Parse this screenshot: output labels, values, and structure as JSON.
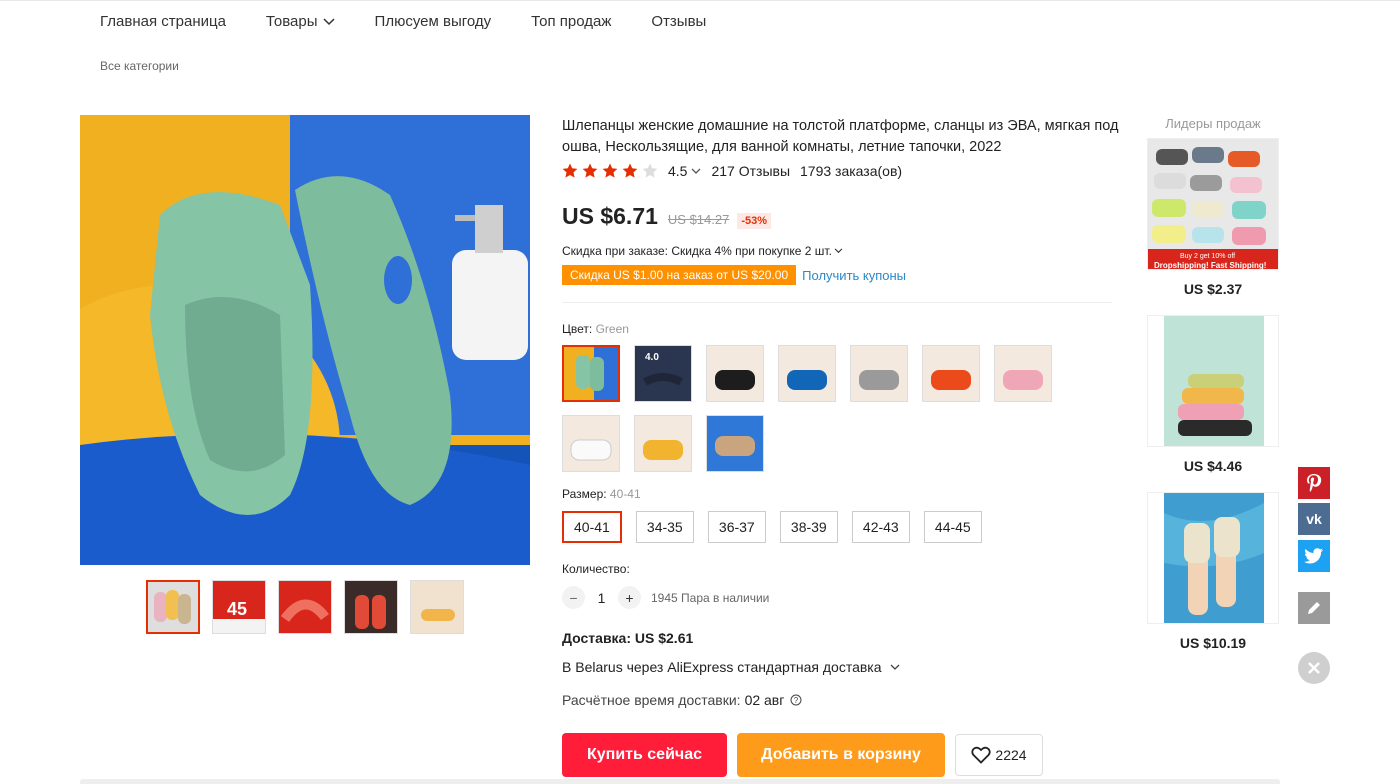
{
  "nav": {
    "home": "Главная страница",
    "products": "Товары",
    "plus": "Плюсуем выгоду",
    "top": "Топ продаж",
    "reviews": "Отзывы"
  },
  "breadcrumb": "Все категории",
  "product": {
    "title": "Шлепанцы женские домашние на толстой платформе, сланцы из ЭВА, мягкая под ошва, Нескользящие, для ванной комнаты, летние тапочки, 2022",
    "rating": "4.5",
    "stars_value": 4.5,
    "reviews": "217 Отзывы",
    "orders": "1793 заказа(ов)",
    "price": "US $6.71",
    "old_price": "US $14.27",
    "discount": "-53%",
    "promo_label": "Скидка при заказе:",
    "promo_text": "Скидка 4% при покупке 2 шт.",
    "coupon": "Скидка US $1.00 на заказ от US $20.00",
    "coupon_link": "Получить купоны"
  },
  "color": {
    "label": "Цвет:",
    "value": "Green"
  },
  "swatch_badge": "4.0",
  "size": {
    "label": "Размер:",
    "value": "40-41",
    "options": [
      "40-41",
      "34-35",
      "36-37",
      "38-39",
      "42-43",
      "44-45"
    ]
  },
  "quantity": {
    "label": "Количество:",
    "value": "1",
    "stock": "1945 Пара в наличии"
  },
  "shipping": {
    "cost": "Доставка: US $2.61",
    "route": "В Belarus через AliExpress стандартная доставка",
    "eta_label": "Расчётное время доставки:",
    "eta_value": "02 авг"
  },
  "actions": {
    "buy": "Купить сейчас",
    "cart": "Добавить в корзину",
    "wish_count": "2224"
  },
  "rail": {
    "title": "Лидеры продаж",
    "banner_top": "Buy 2 get 10% off",
    "banner_bottom": "Dropshipping! Fast Shipping!",
    "prices": [
      "US $2.37",
      "US $4.46",
      "US $10.19"
    ]
  },
  "thumb_text": "45",
  "social": {
    "vk": "vk"
  },
  "colors": {
    "accent": "#e62e04",
    "buy": "#ff1d3a",
    "cart": "#ff9b1a",
    "coupon": "#ff9000"
  }
}
